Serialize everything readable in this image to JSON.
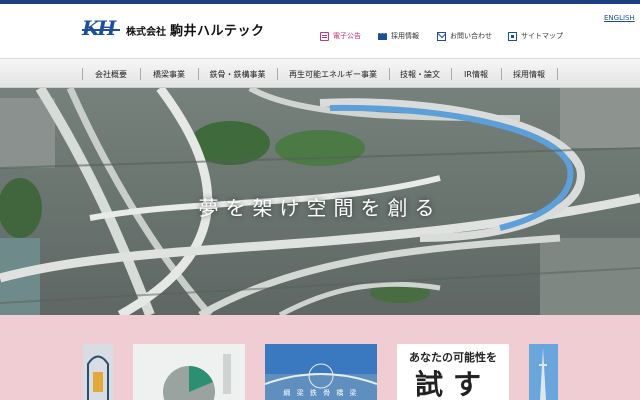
{
  "header": {
    "company_prefix": "株式会社",
    "company_name": "駒井ハルテック",
    "logo_mark": "KH",
    "english_link": "ENGLISH",
    "utility_links": [
      {
        "label": "電子公告",
        "icon": "document-icon"
      },
      {
        "label": "採用情報",
        "icon": "people-icon"
      },
      {
        "label": "お問い合わせ",
        "icon": "mail-icon"
      },
      {
        "label": "サイトマップ",
        "icon": "sitemap-icon"
      }
    ]
  },
  "nav": {
    "items": [
      {
        "label": "会社概要"
      },
      {
        "label": "橋梁事業"
      },
      {
        "label": "鉄骨・鉄構事業"
      },
      {
        "label": "再生可能エネルギー事業"
      },
      {
        "label": "技報・論文"
      },
      {
        "label": "IR情報"
      },
      {
        "label": "採用情報"
      }
    ]
  },
  "hero": {
    "caption": "夢を架け空間を創る"
  },
  "banners": {
    "card_d_line1": "あなたの可能性を",
    "card_d_line2": "試す",
    "card_c_caption": "綱 梁 鉄 骨 橋 梁"
  },
  "colors": {
    "brand_blue": "#1d4e9e",
    "accent_pink": "#c2387a",
    "lower_bg": "#f0cdd3"
  }
}
